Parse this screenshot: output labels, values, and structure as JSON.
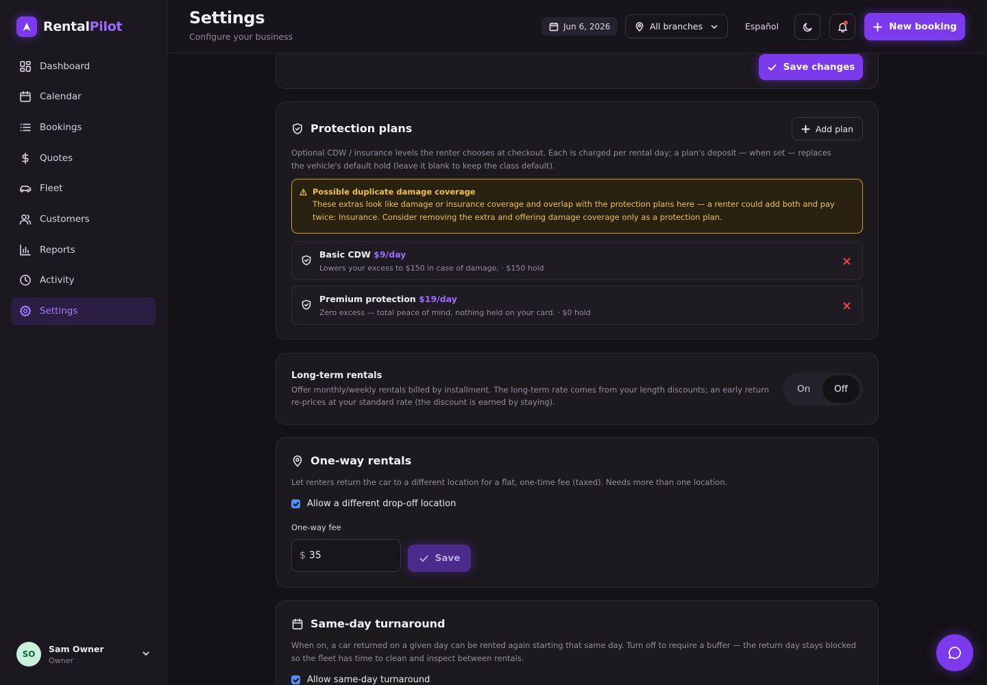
{
  "brand": {
    "name_part1": "Rental",
    "name_part2": "Pilot"
  },
  "sidebar": {
    "items": [
      {
        "label": "Dashboard",
        "icon": "grid-icon"
      },
      {
        "label": "Calendar",
        "icon": "calendar-icon"
      },
      {
        "label": "Bookings",
        "icon": "list-icon"
      },
      {
        "label": "Quotes",
        "icon": "dollar-icon"
      },
      {
        "label": "Fleet",
        "icon": "car-icon"
      },
      {
        "label": "Customers",
        "icon": "users-icon"
      },
      {
        "label": "Reports",
        "icon": "bar-chart-icon"
      },
      {
        "label": "Activity",
        "icon": "clock-icon"
      },
      {
        "label": "Settings",
        "icon": "gear-icon",
        "active": true
      }
    ],
    "user": {
      "initials": "SO",
      "name": "Sam Owner",
      "role": "Owner"
    }
  },
  "header": {
    "title": "Settings",
    "subtitle": "Configure your business",
    "date": "Jun 6, 2026",
    "branch": "All branches",
    "language": "Español",
    "new_booking_label": "New booking"
  },
  "save_changes_label": "Save changes",
  "protection": {
    "title": "Protection plans",
    "add_label": "Add plan",
    "description": "Optional CDW / insurance levels the renter chooses at checkout. Each is charged per rental day; a plan's deposit — when set — replaces the vehicle's default hold (leave it blank to keep the class default).",
    "warning_title": "Possible duplicate damage coverage",
    "warning_body": "These extras look like damage or insurance coverage and overlap with the protection plans here — a renter could add both and pay twice: Insurance. Consider removing the extra and offering damage coverage only as a protection plan.",
    "plans": [
      {
        "name": "Basic CDW",
        "price": "$9/day",
        "detail": "Lowers your excess to $150 in case of damage. · $150 hold"
      },
      {
        "name": "Premium protection",
        "price": "$19/day",
        "detail": "Zero excess — total peace of mind, nothing held on your card. · $0 hold"
      }
    ]
  },
  "long_term": {
    "title": "Long-term rentals",
    "description": "Offer monthly/weekly rentals billed by installment. The long-term rate comes from your length discounts; an early return re-prices at your standard rate (the discount is earned by staying).",
    "on_label": "On",
    "off_label": "Off",
    "selected": "Off"
  },
  "one_way": {
    "title": "One-way rentals",
    "description": "Let renters return the car to a different location for a flat, one-time fee (taxed). Needs more than one location.",
    "checkbox_label": "Allow a different drop-off location",
    "checked": true,
    "fee_label": "One-way fee",
    "currency": "$",
    "fee_value": "35",
    "save_label": "Save"
  },
  "same_day": {
    "title": "Same-day turnaround",
    "description": "When on, a car returned on a given day can be rented again starting that same day. Turn off to require a buffer — the return day stays blocked so the fleet has time to clean and inspect between rentals.",
    "checkbox_label": "Allow same-day turnaround",
    "checked": true
  },
  "colors": {
    "accent": "#7c3aed",
    "accent_text": "#9b6bff",
    "warning": "#c9a022",
    "danger": "#ef4444",
    "checkbox": "#4f8ff7"
  }
}
